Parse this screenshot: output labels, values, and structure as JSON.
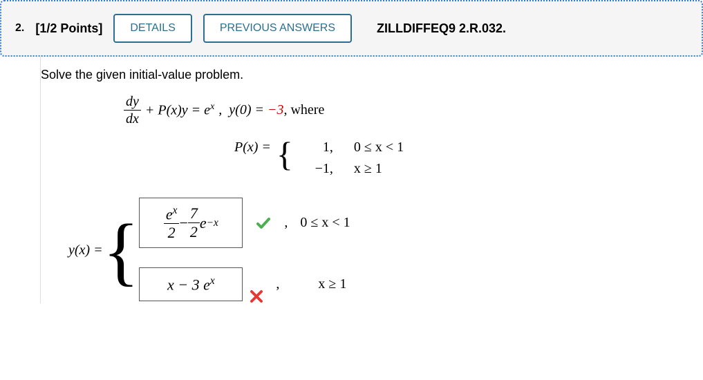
{
  "header": {
    "number": "2.",
    "points": "[1/2 Points]",
    "details_btn": "DETAILS",
    "prev_btn": "PREVIOUS ANSWERS",
    "ref": "ZILLDIFFEQ9 2.R.032."
  },
  "prompt": "Solve the given initial-value problem.",
  "eq": {
    "dy": "dy",
    "dx": "dx",
    "plus_pxy": " + P(x)y = e",
    "sup_x": "x",
    "comma_y0": ",  y(0) = ",
    "neg3": "−3",
    "where": ", where"
  },
  "px": {
    "label": "P(x) = ",
    "v1": "1,",
    "c1": "0 ≤ x < 1",
    "v2": "−1,",
    "c2": "x ≥ 1"
  },
  "ans": {
    "lhs": "y(x) = ",
    "row1": {
      "f1num": "e",
      "f1sup": "x",
      "f1den": "2",
      "minus": " − ",
      "f2num": "7",
      "f2den": "2",
      "e": "e",
      "negx": "−x",
      "cond": "0 ≤ x < 1"
    },
    "row2": {
      "expr_a": "x − 3 ",
      "expr_b": "e",
      "expr_sup": "x",
      "cond": "x ≥ 1"
    },
    "comma": ","
  }
}
